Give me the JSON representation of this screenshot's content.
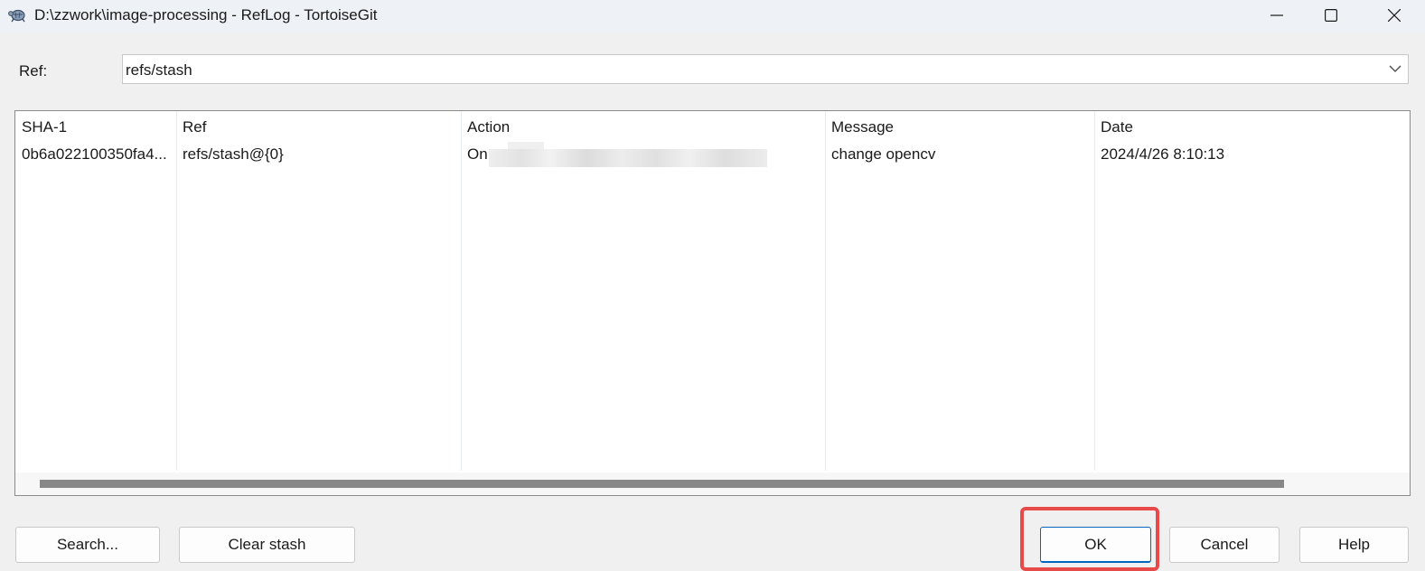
{
  "window": {
    "title": "D:\\zzwork\\image-processing - RefLog - TortoiseGit",
    "icon": "tortoise-icon"
  },
  "ref": {
    "label": "Ref:",
    "value": "refs/stash"
  },
  "list": {
    "columns": [
      "SHA-1",
      "Ref",
      "Action",
      "Message",
      "Date"
    ],
    "rows": [
      {
        "sha": "0b6a022100350fa4...",
        "ref": "refs/stash@{0}",
        "action": "On",
        "message": "change opencv",
        "date": "2024/4/26 8:10:13"
      }
    ]
  },
  "buttons": {
    "search": "Search...",
    "clear_stash": "Clear stash",
    "ok": "OK",
    "cancel": "Cancel",
    "help": "Help"
  },
  "colors": {
    "highlight": "#e84a4a",
    "ok_border": "#0067c0",
    "scroll_thumb": "#888888"
  }
}
